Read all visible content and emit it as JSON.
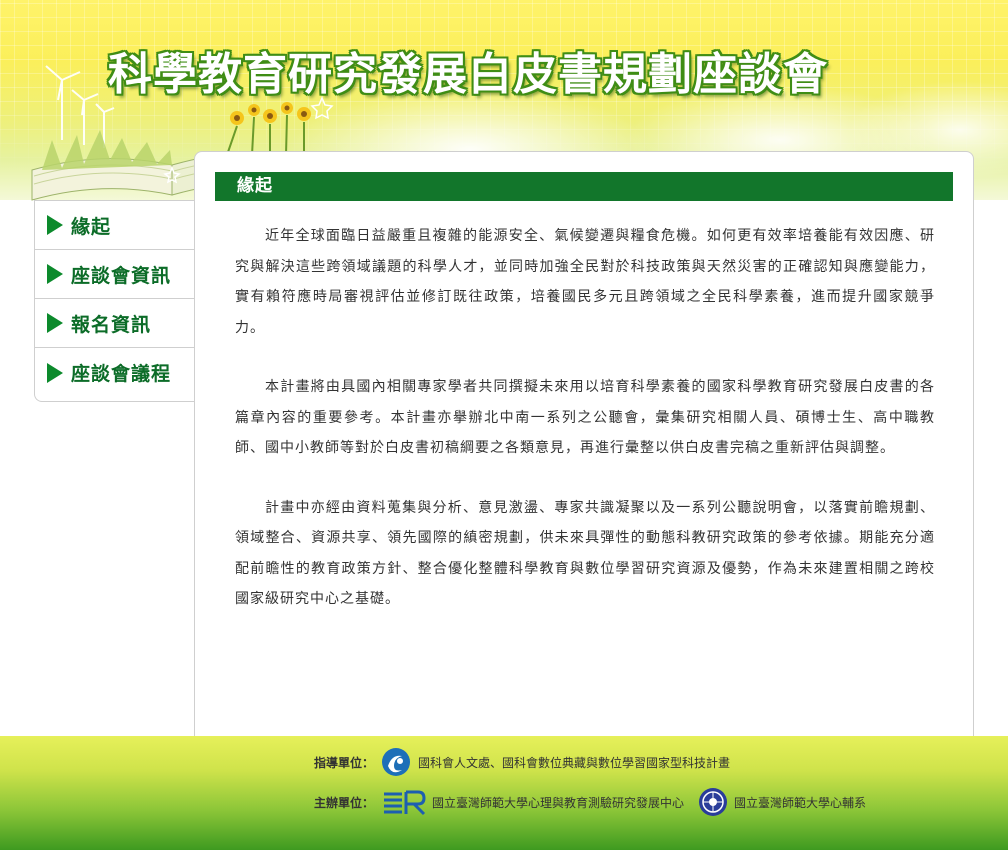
{
  "header": {
    "title": "科學教育研究發展白皮書規劃座談會"
  },
  "sidebar": {
    "items": [
      {
        "label": "緣起"
      },
      {
        "label": "座談會資訊"
      },
      {
        "label": "報名資訊"
      },
      {
        "label": "座談會議程"
      }
    ]
  },
  "main": {
    "section_title": "緣起",
    "paragraphs": [
      "近年全球面臨日益嚴重且複雜的能源安全、氣候變遷與糧食危機。如何更有效率培養能有效因應、研究與解決這些跨領域議題的科學人才，並同時加強全民對於科技政策與天然災害的正確認知與應變能力，實有賴符應時局審視評估並修訂既往政策，培養國民多元且跨領域之全民科學素養，進而提升國家競爭力。",
      "本計畫將由具國內相關專家學者共同撰擬未來用以培育科學素養的國家科學教育研究發展白皮書的各篇章內容的重要參考。本計畫亦擧辦北中南一系列之公聽會，彙集研究相關人員、碩博士生、高中職教師、國中小教師等對於白皮書初稿綱要之各類意見，再進行彙整以供白皮書完稿之重新評估與調整。",
      "計畫中亦經由資料蒐集與分析、意見激盪、專家共識凝聚以及一系列公聽說明會，以落實前瞻規劃、領域整合、資源共享、領先國際的縝密規劃，供未來具彈性的動態科教研究政策的參考依據。期能充分適配前瞻性的教育政策方針、整合優化整體科學教育與數位學習研究資源及優勢，作為未來建置相關之跨校國家級研究中心之基礎。"
    ]
  },
  "footer": {
    "guidance_label": "指導單位：",
    "guidance_org": "國科會人文處、國科會數位典藏與數位學習國家型科技計畫",
    "host_label": "主辦單位：",
    "host_org_1": "國立臺灣師範大學心理與教育測驗研究發展中心",
    "host_org_2": "國立臺灣師範大學心輔系"
  },
  "colors": {
    "brand_green": "#12762b",
    "nav_text": "#0c6c28",
    "header_yellow": "#fff36a"
  }
}
